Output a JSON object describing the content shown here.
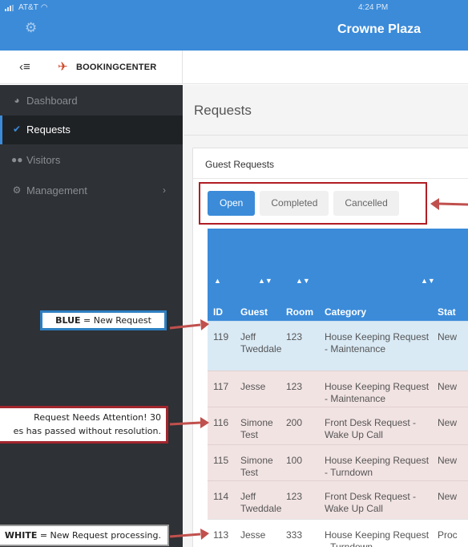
{
  "status_bar": {
    "carrier": "AT&T",
    "time": "4:24 PM"
  },
  "app": {
    "title": "Crowne Plaza"
  },
  "brand": {
    "name": "BOOKINGCENTER"
  },
  "sidebar": {
    "items": [
      {
        "label": "Dashboard",
        "icon": "dashboard-icon"
      },
      {
        "label": "Requests",
        "icon": "check-icon",
        "active": true
      },
      {
        "label": "Visitors",
        "icon": "users-icon"
      },
      {
        "label": "Management",
        "icon": "gear-icon",
        "has_children": true
      }
    ]
  },
  "page": {
    "title": "Requests"
  },
  "panel": {
    "title": "Guest Requests"
  },
  "tabs": [
    {
      "label": "Open",
      "active": true
    },
    {
      "label": "Completed"
    },
    {
      "label": "Cancelled"
    }
  ],
  "table": {
    "columns": [
      "ID",
      "Guest",
      "Room",
      "Category",
      "Stat"
    ],
    "rows": [
      {
        "id": "119",
        "guest": "Jeff Tweddale",
        "room": "123",
        "category": "House Keeping Request - Maintenance",
        "status": "New",
        "state": "blue"
      },
      {
        "id": "117",
        "guest": "Jesse",
        "room": "123",
        "category": "House Keeping Request - Maintenance",
        "status": "New",
        "state": "pink"
      },
      {
        "id": "116",
        "guest": "Simone Test",
        "room": "200",
        "category": "Front Desk Request - Wake Up Call",
        "status": "New",
        "state": "pink"
      },
      {
        "id": "115",
        "guest": "Simone Test",
        "room": "100",
        "category": "House Keeping Request - Turndown",
        "status": "New",
        "state": "pink"
      },
      {
        "id": "114",
        "guest": "Jeff Tweddale",
        "room": "123",
        "category": "Front Desk Request - Wake Up Call",
        "status": "New",
        "state": "pink"
      },
      {
        "id": "113",
        "guest": "Jesse",
        "room": "333",
        "category": "House Keeping Request - Turndown",
        "status": "Proc",
        "state": "white"
      }
    ]
  },
  "callouts": {
    "blue_key": "BLUE",
    "blue_text": " = New Request",
    "red_line1": "Request Needs Attention! 30",
    "red_line2": "es has passed without resolution.",
    "white_key": "WHITE",
    "white_text": " = New Request processing."
  },
  "colors": {
    "primary": "#3b8bd9",
    "sidebar_bg": "#2e3135",
    "row_new": "#d9eaf5",
    "row_attention": "#f2e3e3",
    "callout_red": "#a2262d",
    "callout_blue": "#2e7fc1"
  }
}
